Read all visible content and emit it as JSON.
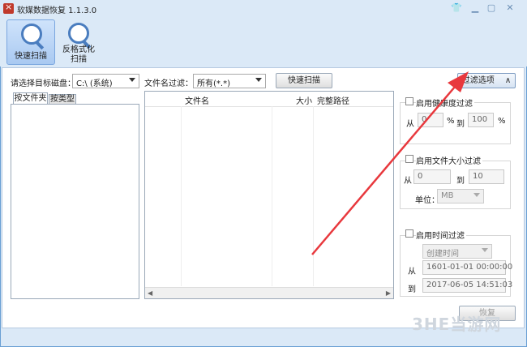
{
  "window": {
    "title": "软媒数据恢复 1.1.3.0"
  },
  "toolbar": {
    "quick_scan": "快速扫描",
    "reformat_scan_line1": "反格式化",
    "reformat_scan_line2": "扫描"
  },
  "scan": {
    "disk_label": "请选择目标磁盘：",
    "disk_value": "C:\\  (系统)",
    "filter_label": "文件名过滤：",
    "filter_value": "所有(*.*)",
    "scan_button": "快速扫描",
    "filter_options_button": "过滤选项",
    "filter_options_arrow": "∧"
  },
  "tabs": {
    "by_folder": "按文件夹",
    "by_type": "按类型"
  },
  "file_list": {
    "columns": {
      "name": "文件名",
      "size": "大小",
      "path": "完整路径"
    }
  },
  "health_filter": {
    "label": "启用健康度过滤",
    "from_label": "从",
    "from_value": "0",
    "pct1": "%",
    "to_label": "到",
    "to_value": "100",
    "pct2": "%"
  },
  "size_filter": {
    "label": "启用文件大小过滤",
    "from_label": "从",
    "from_value": "0",
    "to_label": "到",
    "to_value": "10",
    "unit_label": "单位：",
    "unit_value": "MB"
  },
  "time_filter": {
    "label": "启用时间过滤",
    "type_value": "创建时间",
    "from_label": "从",
    "from_value": "1601-01-01 00:00:00",
    "to_label": "到",
    "to_value": "2017-06-05 14:51:03"
  },
  "recover_button": "恢复",
  "watermark": "3HE当游网",
  "colors": {
    "arrow": "#e8383d",
    "accent": "#4a7dbf"
  }
}
